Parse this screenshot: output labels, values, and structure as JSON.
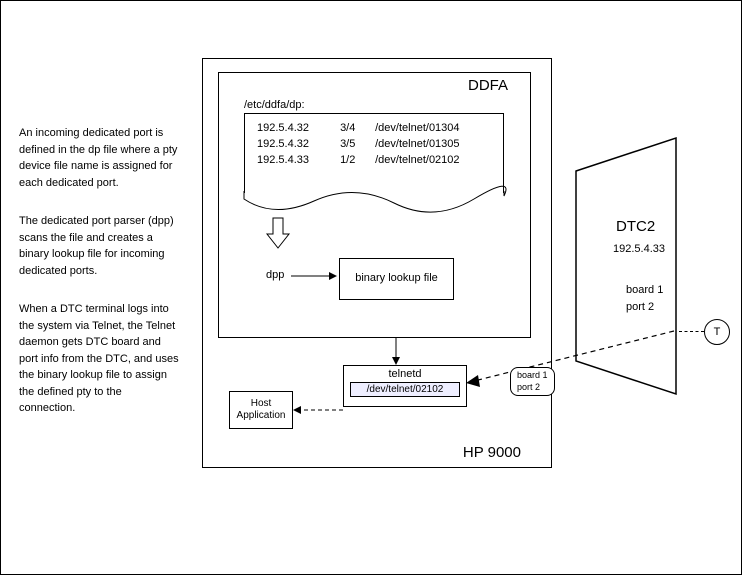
{
  "description": {
    "p1": "An incoming dedicated port is defined in the dp file where a pty device file name is assigned for each dedicated port.",
    "p2": "The dedicated port parser (dpp) scans the file and creates a binary lookup file for incoming dedicated ports.",
    "p3": "When a DTC terminal logs into the system via Telnet, the Telnet daemon gets DTC board and port info from the DTC, and uses the binary lookup file to assign the defined pty to the connection."
  },
  "hp9000": {
    "label": "HP 9000"
  },
  "ddfa": {
    "label": "DDFA",
    "dpfile_path": "/etc/ddfa/dp:",
    "rows": [
      {
        "ip": "192.5.4.32",
        "bp": "3/4",
        "dev": "/dev/telnet/01304"
      },
      {
        "ip": "192.5.4.32",
        "bp": "3/5",
        "dev": "/dev/telnet/01305"
      },
      {
        "ip": "192.5.4.33",
        "bp": "1/2",
        "dev": "/dev/telnet/02102"
      }
    ],
    "dpp": "dpp",
    "binlookup": "binary lookup file"
  },
  "telnetd": {
    "label": "telnetd",
    "dev": "/dev/telnet/02102"
  },
  "host": {
    "label": "Host Application"
  },
  "dtc": {
    "name": "DTC2",
    "ip": "192.5.4.33",
    "board": "board 1",
    "port": "port 2",
    "terminal": "T"
  },
  "bubble": {
    "board": "board 1",
    "port": "port 2"
  }
}
